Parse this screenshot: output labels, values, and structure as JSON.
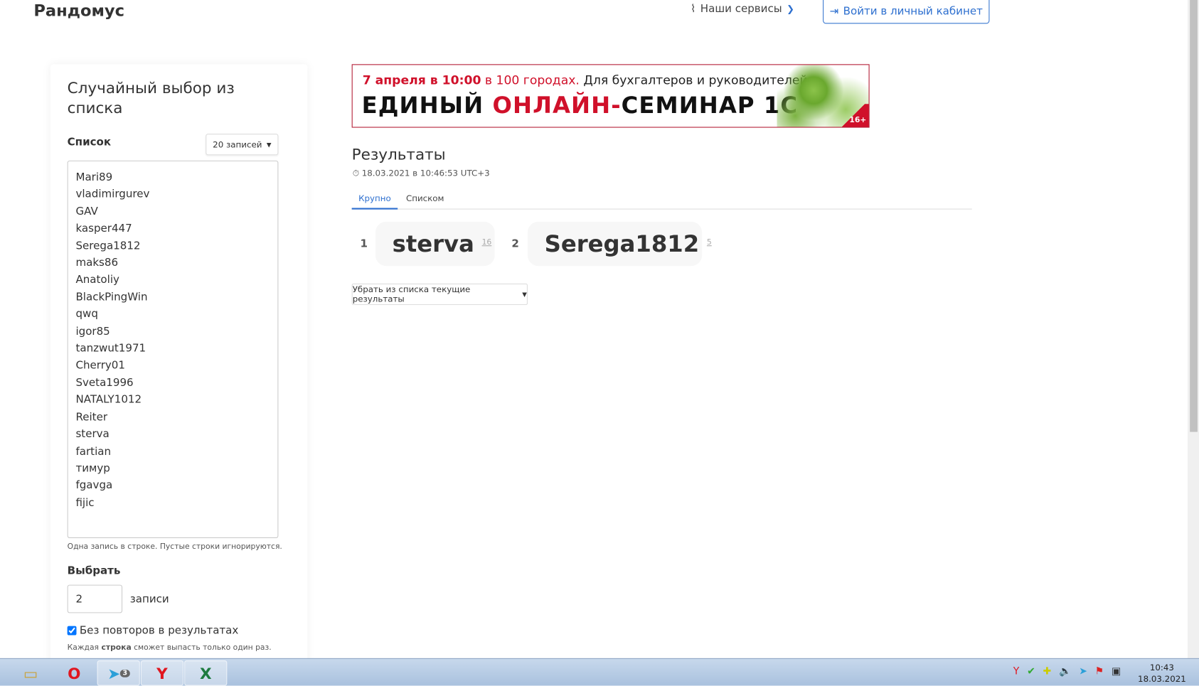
{
  "header": {
    "logo": "Рандомус",
    "services": "Наши сервисы",
    "login": "Войти в личный кабинет"
  },
  "form": {
    "title": "Случайный выбор из списка",
    "list_label": "Список",
    "count_select": "20 записей",
    "items": [
      "Mari89",
      "vladimirgurev",
      "GAV",
      "kasper447",
      "Serega1812",
      "maks86",
      "Anatoliy",
      "BlackPingWin",
      "qwq",
      "igor85",
      "tanzwut1971",
      "Cherry01",
      "Sveta1996",
      "NATALY1012",
      "Reiter",
      "sterva",
      "fartian",
      "тимур",
      "fgavga",
      "fijic"
    ],
    "list_hint": "Одна запись в строке. Пустые строки игнорируются.",
    "pick_label": "Выбрать",
    "pick_value": "2",
    "pick_unit": "записи",
    "no_repeat_label": "Без повторов в результатах",
    "no_repeat_checked": true,
    "note_pre": "Каждая ",
    "note_bold": "строка",
    "note_post": " сможет выпасть только один раз."
  },
  "banner": {
    "date": "7 апреля в 10:00",
    "cities": " в 100 городах.",
    "audience": " Для бухгалтеров и руководителей",
    "line2a": "ЕДИНЫЙ ",
    "line2b": "ОНЛАЙН-",
    "line2c": "СЕМИНАР 1С",
    "age": "16+"
  },
  "results": {
    "title": "Результаты",
    "timestamp": "18.03.2021 в 10:46:53 UTC+3",
    "tabs": [
      "Крупно",
      "Списком"
    ],
    "winners": [
      {
        "rank": "1",
        "name": "sterva",
        "line": "16"
      },
      {
        "rank": "2",
        "name": "Serega1812",
        "line": "5"
      }
    ],
    "remove_button": "Убрать из списка текущие результаты"
  },
  "taskbar": {
    "time": "10:43",
    "date": "18.03.2021",
    "telegram_badge": "3"
  }
}
